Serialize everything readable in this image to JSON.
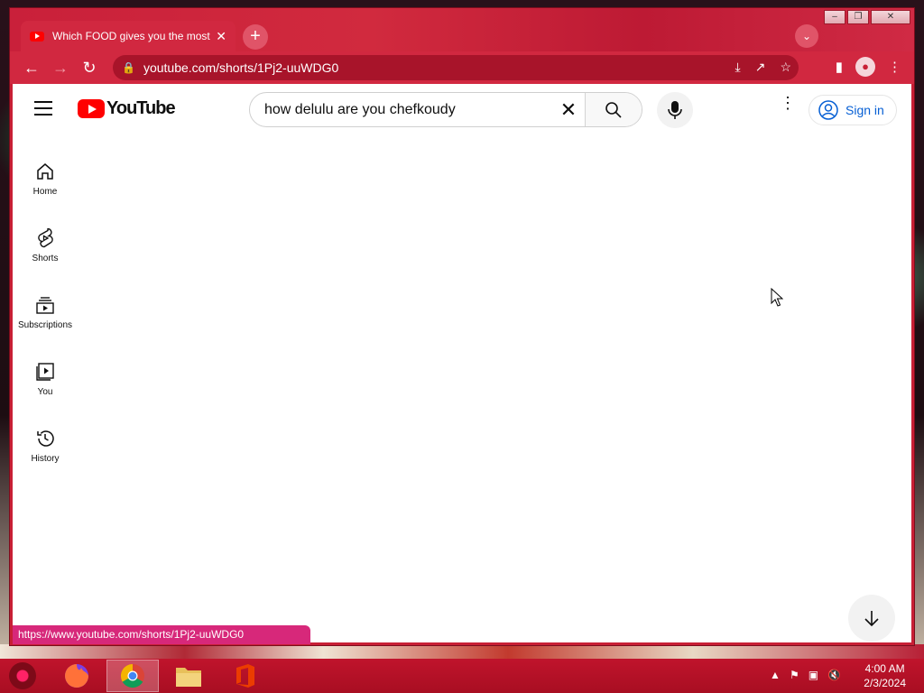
{
  "browser": {
    "tab_title": "Which FOOD gives you the most",
    "tab_close": "✕",
    "new_tab": "+",
    "url": "youtube.com/shorts/1Pj2-uuWDG0",
    "status_url": "https://www.youtube.com/shorts/1Pj2-uuWDG0"
  },
  "youtube": {
    "logo_text": "YouTube",
    "search_value": "how delulu are you chefkoudy",
    "signin_label": "Sign in",
    "sidebar": [
      {
        "label": "Home",
        "icon": "home-icon"
      },
      {
        "label": "Shorts",
        "icon": "shorts-icon"
      },
      {
        "label": "Subscriptions",
        "icon": "subscriptions-icon"
      },
      {
        "label": "You",
        "icon": "you-icon"
      },
      {
        "label": "History",
        "icon": "history-icon"
      }
    ]
  },
  "taskbar": {
    "time": "4:00 AM",
    "date": "2/3/2024"
  },
  "colors": {
    "brand_red": "#ff0000",
    "chrome_theme": "#c81f35",
    "link_blue": "#065fd4"
  }
}
